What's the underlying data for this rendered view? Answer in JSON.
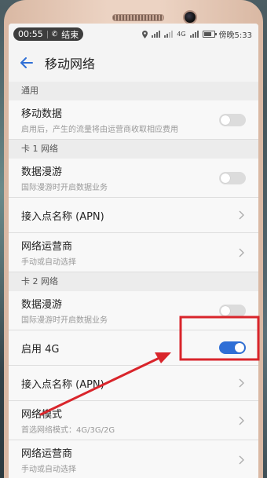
{
  "status": {
    "time": "00:55",
    "end_label": "结束",
    "right_time": "傍晚5:33",
    "network": "4G"
  },
  "header": {
    "title": "移动网络"
  },
  "sections": {
    "general": "通用",
    "card1": "卡 1 网络",
    "card2": "卡 2 网络"
  },
  "items": {
    "mobile_data": {
      "label": "移动数据",
      "sub": "启用后，产生的流量将由运营商收取相应费用",
      "on": false
    },
    "c1_roaming": {
      "label": "数据漫游",
      "sub": "国际漫游时开启数据业务",
      "on": false
    },
    "c1_apn": {
      "label": "接入点名称 (APN)"
    },
    "c1_operator": {
      "label": "网络运营商",
      "sub": "手动或自动选择"
    },
    "c2_roaming": {
      "label": "数据漫游",
      "sub": "国际漫游时开启数据业务",
      "on": false
    },
    "c2_4g": {
      "label": "启用 4G",
      "on": true
    },
    "c2_apn": {
      "label": "接入点名称 (APN)"
    },
    "c2_mode": {
      "label": "网络模式",
      "sub": "首选网络模式：4G/3G/2G"
    },
    "c2_operator": {
      "label": "网络运营商",
      "sub": "手动或自动选择"
    }
  },
  "colors": {
    "accent": "#2f6fd6",
    "annotation": "#d9252b"
  }
}
